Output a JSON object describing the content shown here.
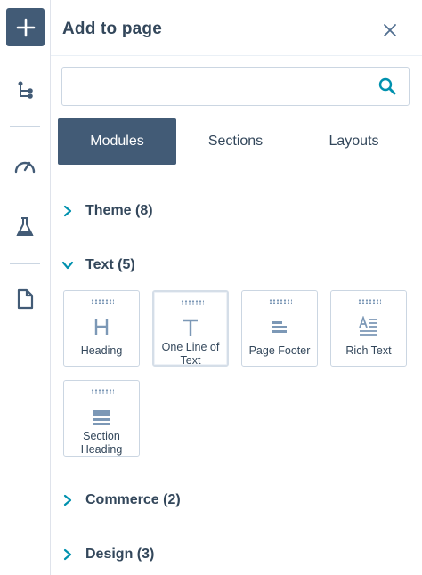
{
  "rail": {
    "items": [
      {
        "name": "add",
        "icon": "plus-icon"
      },
      {
        "name": "tree",
        "icon": "tree-structure-icon"
      },
      {
        "name": "optimize",
        "icon": "speedometer-icon"
      },
      {
        "name": "test",
        "icon": "flask-icon"
      },
      {
        "name": "page",
        "icon": "document-icon"
      }
    ]
  },
  "panel": {
    "title": "Add to page",
    "search": {
      "value": "",
      "placeholder": ""
    },
    "tabs": [
      {
        "label": "Modules",
        "active": true
      },
      {
        "label": "Sections",
        "active": false
      },
      {
        "label": "Layouts",
        "active": false
      }
    ],
    "sections": [
      {
        "label": "Theme (8)",
        "expanded": false
      },
      {
        "label": "Text (5)",
        "expanded": true,
        "modules": [
          {
            "label": "Heading",
            "icon": "heading-icon"
          },
          {
            "label": "One Line of Text",
            "icon": "text-line-icon"
          },
          {
            "label": "Page Footer",
            "icon": "page-footer-icon"
          },
          {
            "label": "Rich Text",
            "icon": "rich-text-icon"
          },
          {
            "label": "Section Heading",
            "icon": "section-heading-icon"
          }
        ]
      },
      {
        "label": "Commerce (2)",
        "expanded": false
      },
      {
        "label": "Design (3)",
        "expanded": false
      }
    ]
  },
  "colors": {
    "primary": "#425b76",
    "accent": "#0091ae",
    "text": "#33475b",
    "border": "#cbd6e2"
  }
}
